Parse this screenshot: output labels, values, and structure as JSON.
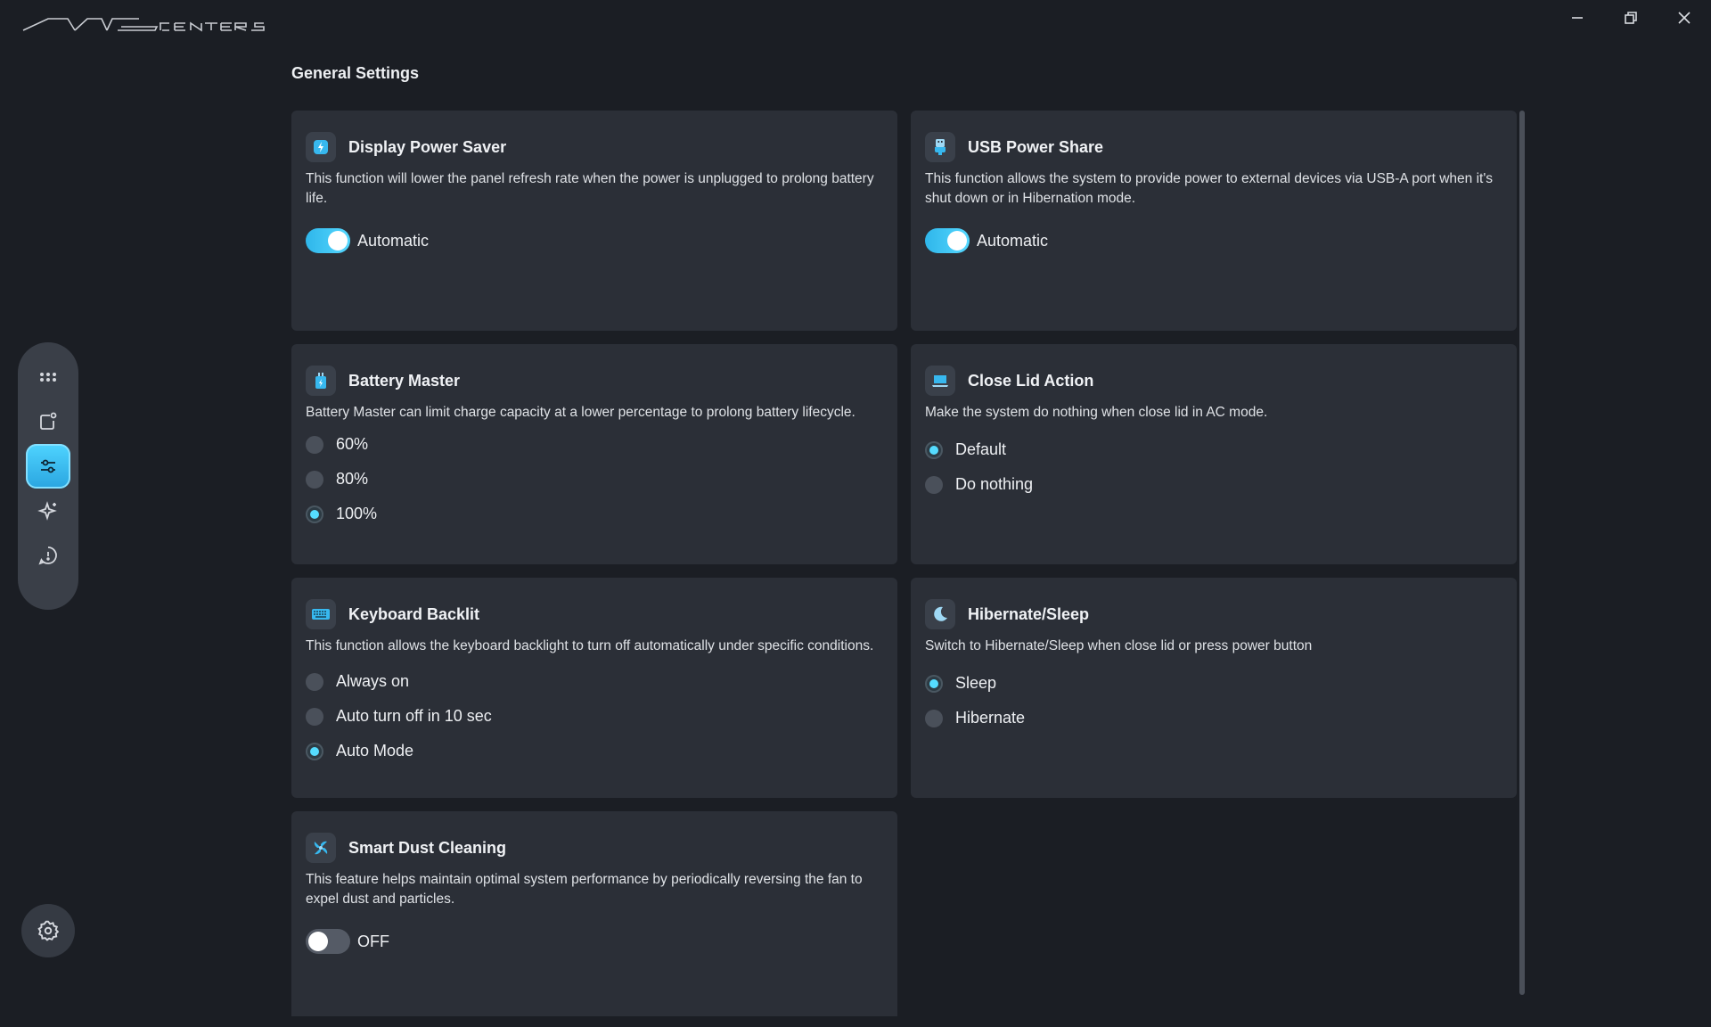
{
  "app": {
    "logo_text": "MSI CENTER S"
  },
  "window": {
    "minimize_icon": "minimize-icon",
    "restore_icon": "restore-icon",
    "close_icon": "close-icon"
  },
  "nav": {
    "items": [
      {
        "icon": "apps-grid-icon",
        "active": false
      },
      {
        "icon": "device-icon",
        "active": false
      },
      {
        "icon": "sliders-icon",
        "active": true
      },
      {
        "icon": "sparkle-icon",
        "active": false
      },
      {
        "icon": "alert-circle-icon",
        "active": false
      }
    ],
    "settings_icon": "gear-icon"
  },
  "page": {
    "title": "General Settings"
  },
  "colors": {
    "accent": "#55dcff",
    "card_bg": "#2b2f37",
    "page_bg": "#1b1e24"
  },
  "cards": {
    "display_power_saver": {
      "title": "Display Power Saver",
      "desc": "This function will lower the panel refresh rate when the power is unplugged to prolong battery life.",
      "toggle_label": "Automatic",
      "toggle_on": true
    },
    "usb_power_share": {
      "title": "USB Power Share",
      "desc": "This function allows the system to provide power to external devices via USB-A port when it's shut down or in Hibernation mode.",
      "toggle_label": "Automatic",
      "toggle_on": true
    },
    "battery_master": {
      "title": "Battery Master",
      "desc": "Battery Master can limit charge capacity at a lower percentage to prolong battery lifecycle.",
      "options": [
        "60%",
        "80%",
        "100%"
      ],
      "selected": "100%"
    },
    "close_lid_action": {
      "title": "Close Lid Action",
      "desc": "Make the system do nothing when close lid in AC mode.",
      "options": [
        "Default",
        "Do nothing"
      ],
      "selected": "Default"
    },
    "keyboard_backlit": {
      "title": "Keyboard Backlit",
      "desc": "This function allows the keyboard backlight to turn off automatically under specific conditions.",
      "options": [
        "Always on",
        "Auto turn off in 10 sec",
        "Auto Mode"
      ],
      "selected": "Auto Mode"
    },
    "hibernate_sleep": {
      "title": "Hibernate/Sleep",
      "desc": "Switch to Hibernate/Sleep when close lid or press power button",
      "options": [
        "Sleep",
        "Hibernate"
      ],
      "selected": "Sleep"
    },
    "smart_dust_cleaning": {
      "title": "Smart Dust Cleaning",
      "desc": "This feature helps maintain optimal system performance by periodically reversing the fan to expel dust and particles.",
      "toggle_label": "OFF",
      "toggle_on": false
    }
  }
}
